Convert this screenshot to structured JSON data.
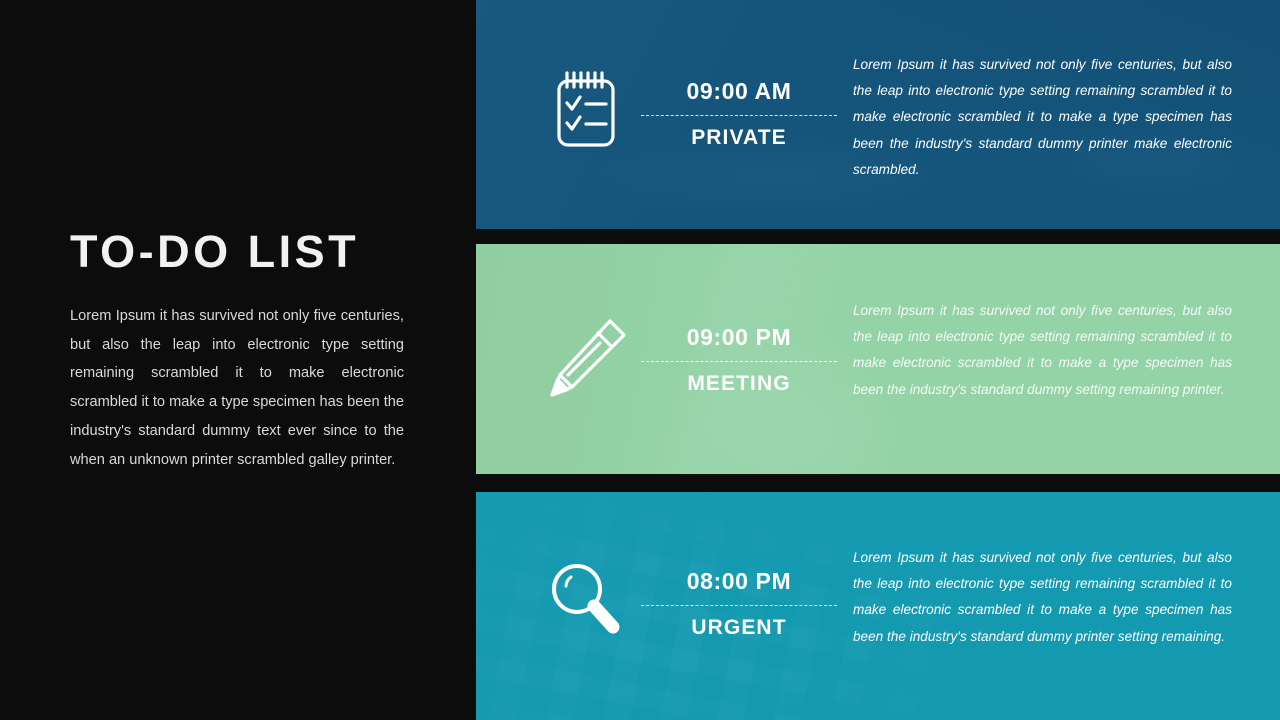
{
  "slide": {
    "title": "TO-DO LIST",
    "intro": "Lorem Ipsum it has survived not only five centuries, but also the leap into electronic type setting remaining scrambled it to make electronic scrambled it to make a type specimen has been the industry's standard dummy text ever since to the when an unknown printer scrambled galley printer."
  },
  "colors": {
    "background": "#0d0c0c",
    "title_text": "#f1f1f1",
    "body_text": "#d9d9d9",
    "band_1": "#15557c",
    "band_2": "#94d3a6",
    "band_3": "#1399b0",
    "accent_white": "#ffffff"
  },
  "tasks": [
    {
      "icon": "notepad-checklist-icon",
      "time": "09:00 AM",
      "label": "PRIVATE",
      "description": "Lorem Ipsum it has survived not only five centuries, but also the leap into electronic type setting remaining scrambled it to make electronic scrambled it to make a type specimen has been the industry's standard dummy printer make electronic scrambled.",
      "color": "#15557c"
    },
    {
      "icon": "pencil-icon",
      "time": "09:00 PM",
      "label": "MEETING",
      "description": "Lorem Ipsum it has survived not only five centuries, but also the leap into electronic type setting remaining scrambled it to make electronic scrambled it to make a type specimen has been the industry's standard dummy setting remaining printer.",
      "color": "#94d3a6"
    },
    {
      "icon": "magnifier-icon",
      "time": "08:00 PM",
      "label": "URGENT",
      "description": "Lorem Ipsum it has survived not only five centuries, but also the leap into electronic type setting remaining scrambled it to make electronic scrambled it to make a type specimen has been the industry's standard dummy printer setting remaining.",
      "color": "#1399b0"
    }
  ]
}
